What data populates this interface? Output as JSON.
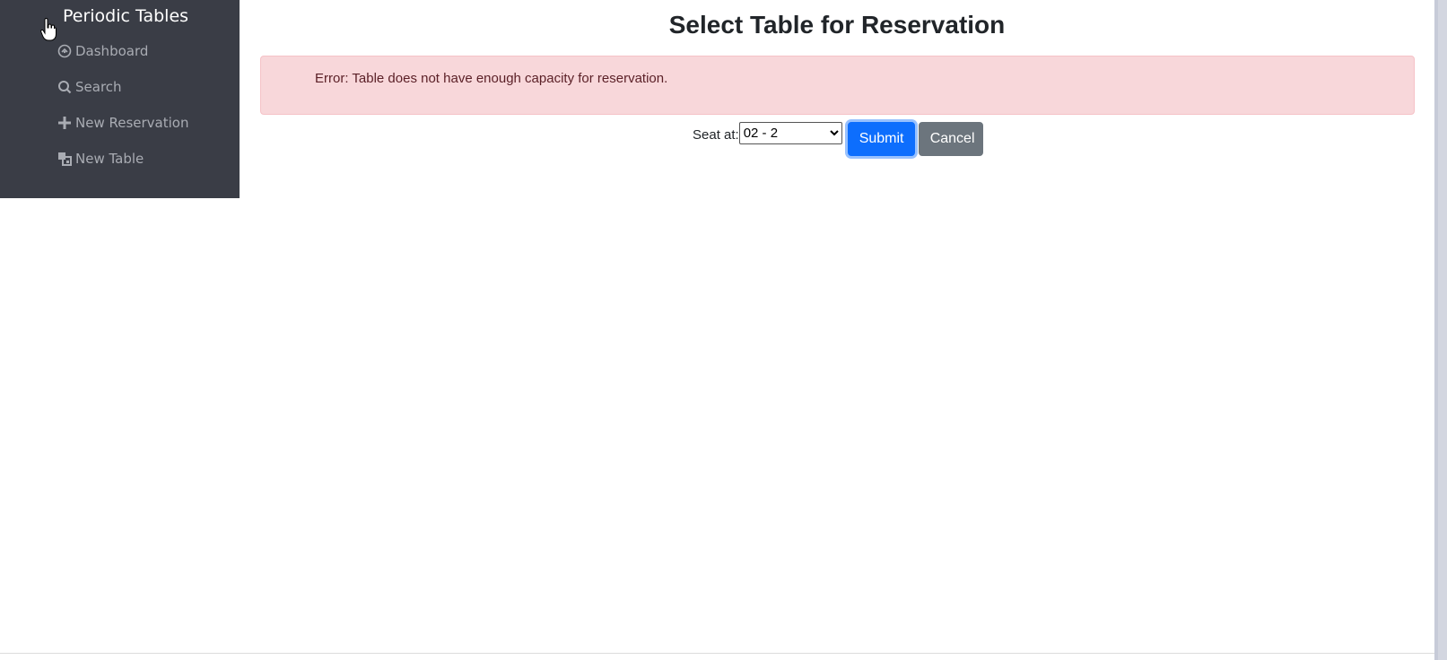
{
  "sidebar": {
    "brand": "Periodic Tables",
    "items": [
      {
        "label": "Dashboard",
        "icon": "dashboard-icon"
      },
      {
        "label": "Search",
        "icon": "search-icon"
      },
      {
        "label": "New Reservation",
        "icon": "plus-icon"
      },
      {
        "label": "New Table",
        "icon": "table-icon"
      }
    ]
  },
  "main": {
    "title": "Select Table for Reservation",
    "error": "Error: Table does not have enough capacity for reservation.",
    "seat_label": "Seat at:",
    "seat_value": "02 - 2",
    "submit_label": "Submit",
    "cancel_label": "Cancel"
  },
  "colors": {
    "sidebar_bg": "#3a3d46",
    "alert_bg": "#f8d7da",
    "primary": "#0d6efd",
    "secondary": "#6c757d"
  }
}
